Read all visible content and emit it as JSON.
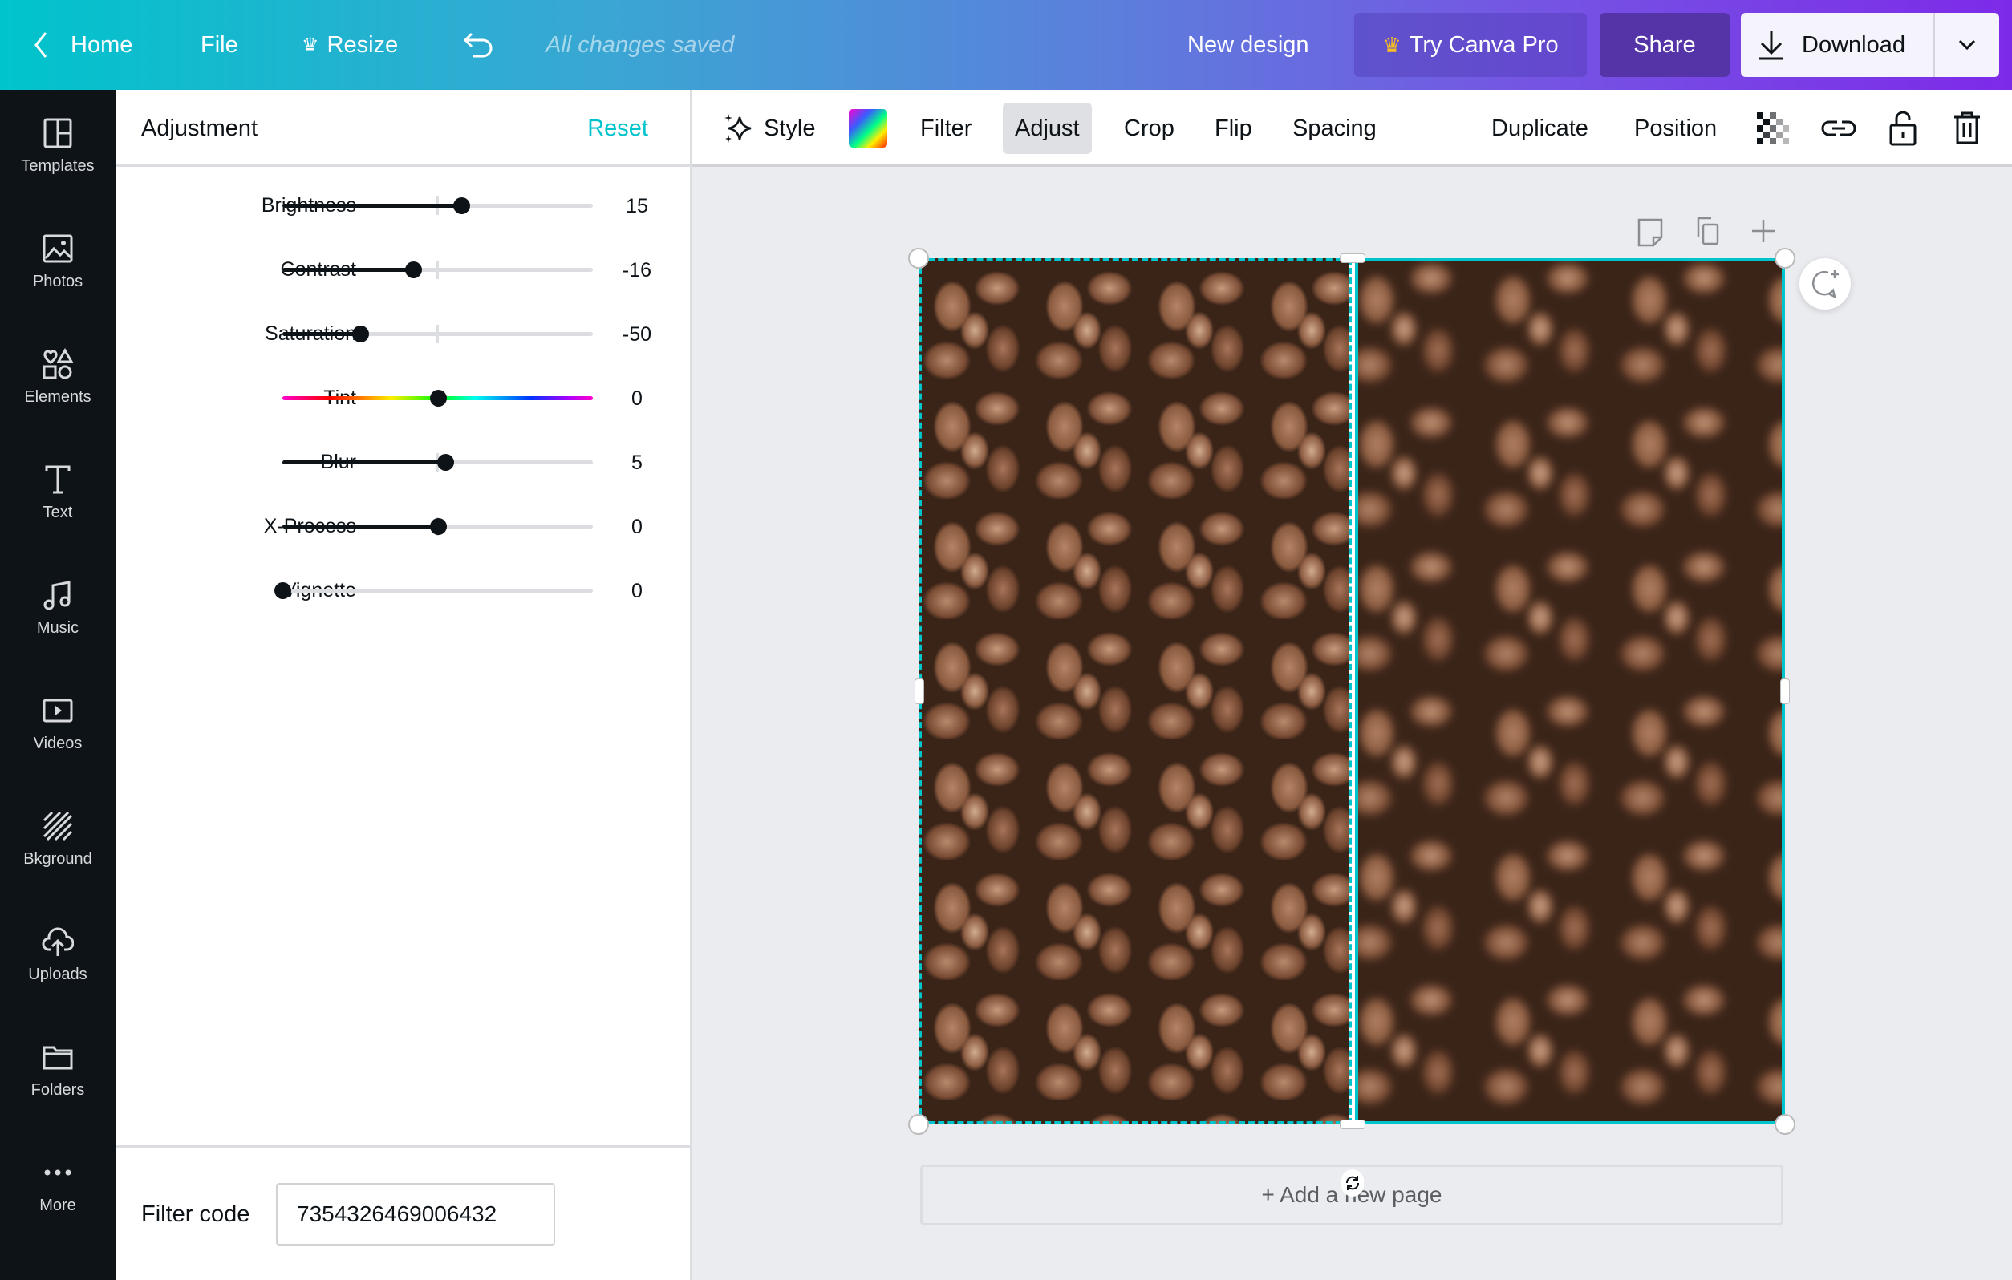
{
  "topbar": {
    "home": "Home",
    "file": "File",
    "resize": "Resize",
    "status": "All changes saved",
    "new_design": "New design",
    "try_pro": "Try Canva Pro",
    "share": "Share",
    "download": "Download"
  },
  "sidebar": {
    "items": [
      {
        "label": "Templates",
        "icon": "templates-icon"
      },
      {
        "label": "Photos",
        "icon": "photos-icon"
      },
      {
        "label": "Elements",
        "icon": "elements-icon"
      },
      {
        "label": "Text",
        "icon": "text-icon"
      },
      {
        "label": "Music",
        "icon": "music-icon"
      },
      {
        "label": "Videos",
        "icon": "videos-icon"
      },
      {
        "label": "Bkground",
        "icon": "background-icon"
      },
      {
        "label": "Uploads",
        "icon": "uploads-icon"
      },
      {
        "label": "Folders",
        "icon": "folders-icon"
      },
      {
        "label": "More",
        "icon": "more-icon"
      }
    ]
  },
  "panel": {
    "title": "Adjustment",
    "reset": "Reset",
    "sliders": [
      {
        "label": "Brightness",
        "value": 15,
        "min": -100,
        "max": 100,
        "display": "15"
      },
      {
        "label": "Contrast",
        "value": -16,
        "min": -100,
        "max": 100,
        "display": "-16"
      },
      {
        "label": "Saturation",
        "value": -50,
        "min": -100,
        "max": 100,
        "display": "-50"
      },
      {
        "label": "Tint",
        "value": 0,
        "min": -100,
        "max": 100,
        "display": "0"
      },
      {
        "label": "Blur",
        "value": 5,
        "min": -100,
        "max": 100,
        "display": "5"
      },
      {
        "label": "X-Process",
        "value": 0,
        "min": -100,
        "max": 100,
        "display": "0"
      },
      {
        "label": "Vignette",
        "value": 0,
        "min": 0,
        "max": 100,
        "display": "0"
      }
    ],
    "filter_code_label": "Filter code",
    "filter_code_value": "7354326469006432"
  },
  "toolbar": {
    "style": "Style",
    "filter": "Filter",
    "adjust": "Adjust",
    "crop": "Crop",
    "flip": "Flip",
    "spacing": "Spacing",
    "duplicate": "Duplicate",
    "position": "Position"
  },
  "canvas": {
    "add_page": "+ Add a new page"
  },
  "colors": {
    "accent": "#00c4cc",
    "purple": "#7d2ae8",
    "sidebar": "#0e1318",
    "selection": "#00c4cc",
    "crown": "#fbbf24"
  }
}
